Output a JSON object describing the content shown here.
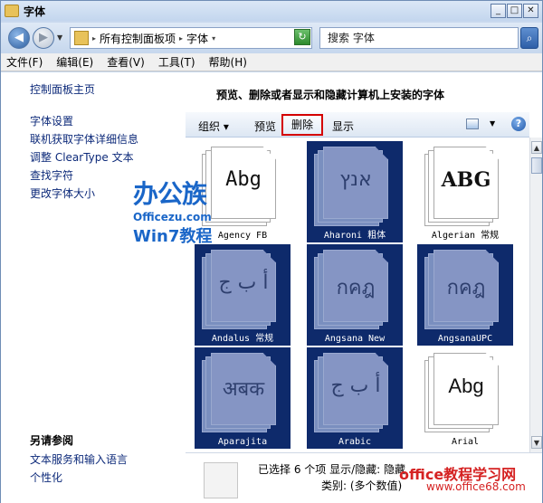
{
  "window": {
    "title": "字体",
    "minimize": "_",
    "maximize": "□",
    "close": "✕"
  },
  "address": {
    "crumbs": [
      "所有控制面板项",
      "字体"
    ],
    "search_placeholder": "搜索 字体"
  },
  "menu": [
    "文件(F)",
    "编辑(E)",
    "查看(V)",
    "工具(T)",
    "帮助(H)"
  ],
  "sidebar": {
    "home": "控制面板主页",
    "links": [
      "字体设置",
      "联机获取字体详细信息",
      "调整 ClearType 文本",
      "查找字符",
      "更改字体大小"
    ],
    "see_also_title": "另请参阅",
    "see_also": [
      "文本服务和输入语言",
      "个性化"
    ]
  },
  "main": {
    "heading": "预览、删除或者显示和隐藏计算机上安装的字体",
    "toolbar": {
      "organize": "组织",
      "preview": "预览",
      "delete": "删除",
      "show": "显示"
    }
  },
  "fonts": [
    {
      "name": "Agency FB",
      "glyph": "Abg",
      "selected": false
    },
    {
      "name": "Aharoni 粗体",
      "glyph": "אנץ",
      "selected": true
    },
    {
      "name": "Algerian 常规",
      "glyph": "ABG",
      "selected": false
    },
    {
      "name": "Andalus 常规",
      "glyph": "أ ب ج",
      "selected": true
    },
    {
      "name": "Angsana New",
      "glyph": "กคฎ",
      "selected": true
    },
    {
      "name": "AngsanaUPC",
      "glyph": "กคฎ",
      "selected": true
    },
    {
      "name": "Aparajita",
      "glyph": "अबक",
      "selected": true
    },
    {
      "name": "Arabic",
      "glyph": "أ ب ج",
      "selected": true
    },
    {
      "name": "Arial",
      "glyph": "Abg",
      "selected": false
    }
  ],
  "status": {
    "selected_line": "已选择 6 个项 显示/隐藏: 隐藏",
    "category_line": "类别: (多个数值)"
  },
  "watermarks": {
    "logo_main": "办公族",
    "logo_url": "Officezu.com",
    "logo_sub": "Win7教程",
    "site_title": "office教程学习网",
    "site_url": "www.office68.com"
  },
  "colors": {
    "selection": "#0e2a6b",
    "link": "#0d2a7a",
    "delete_highlight": "#d40000"
  }
}
